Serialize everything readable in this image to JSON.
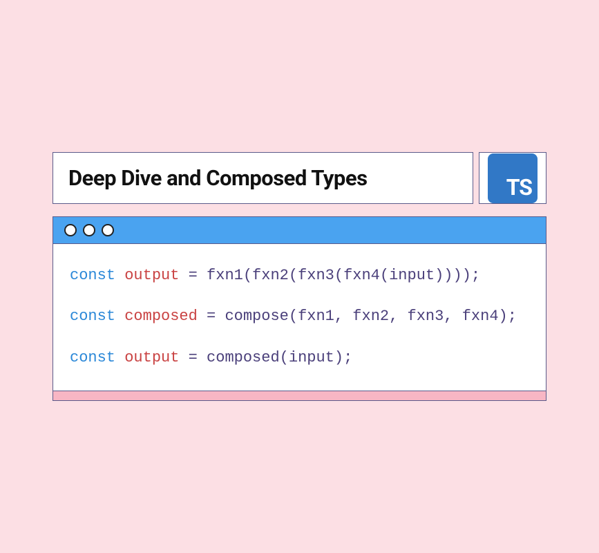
{
  "header": {
    "title": "Deep Dive and Composed Types",
    "logo_text": "TS"
  },
  "code": {
    "line1": {
      "kw": "const",
      "var": "output",
      "eq": " = ",
      "rest": "fxn1(fxn2(fxn3(fxn4(input))));"
    },
    "line2": {
      "kw": "const",
      "var": "composed",
      "eq": " = ",
      "rest": "compose(fxn1, fxn2, fxn3, fxn4);"
    },
    "line3": {
      "kw": "const",
      "var": "output",
      "eq": " = ",
      "rest": "composed(input);"
    }
  }
}
